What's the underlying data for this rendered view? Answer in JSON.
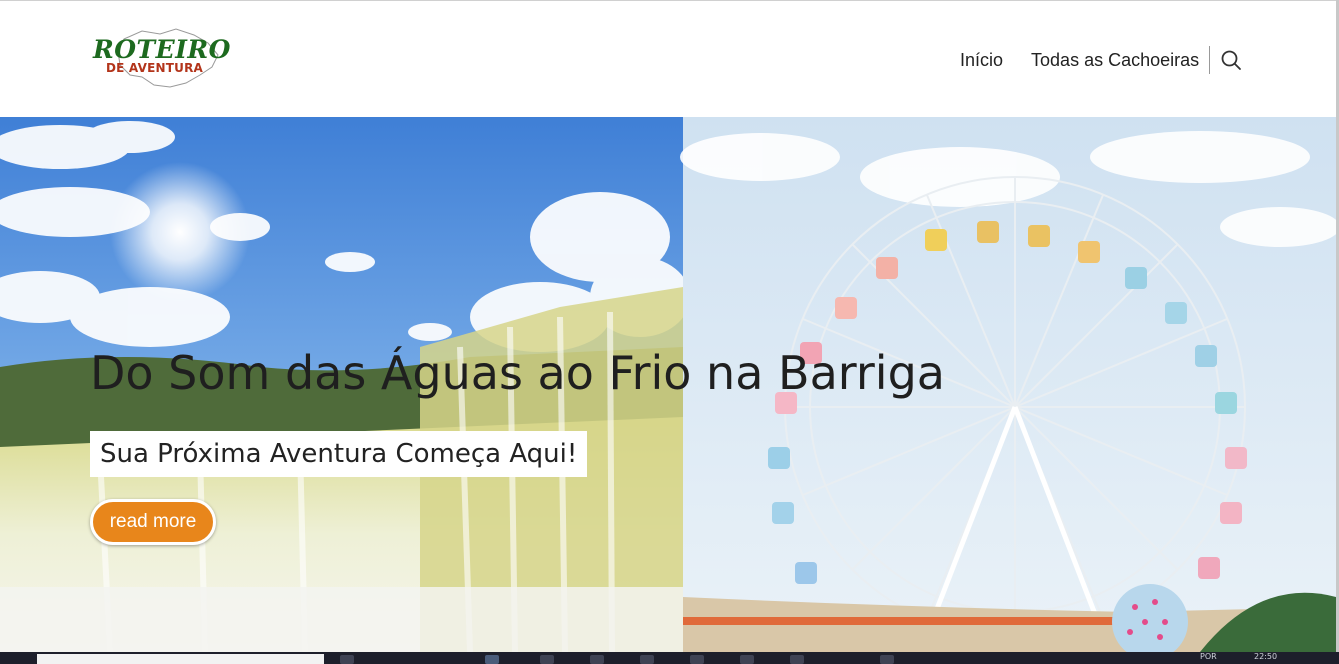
{
  "brand": {
    "logo_line1": "ROTEIRO",
    "logo_line2": "DE AVENTURA",
    "colors": {
      "green": "#1d6a1f",
      "red": "#b3341a"
    }
  },
  "nav": {
    "items": [
      {
        "label": "Início"
      },
      {
        "label": "Todas as Cachoeiras"
      }
    ],
    "search_icon": "search-icon"
  },
  "hero": {
    "title": "Do Som das Águas ao Frio na Barriga",
    "subtitle": "Sua Próxima Aventura Começa Aqui!",
    "button_label": "read more",
    "button_color": "#e8861b"
  },
  "taskbar": {
    "tray_lang": "POR",
    "tray_time": "22:50"
  }
}
